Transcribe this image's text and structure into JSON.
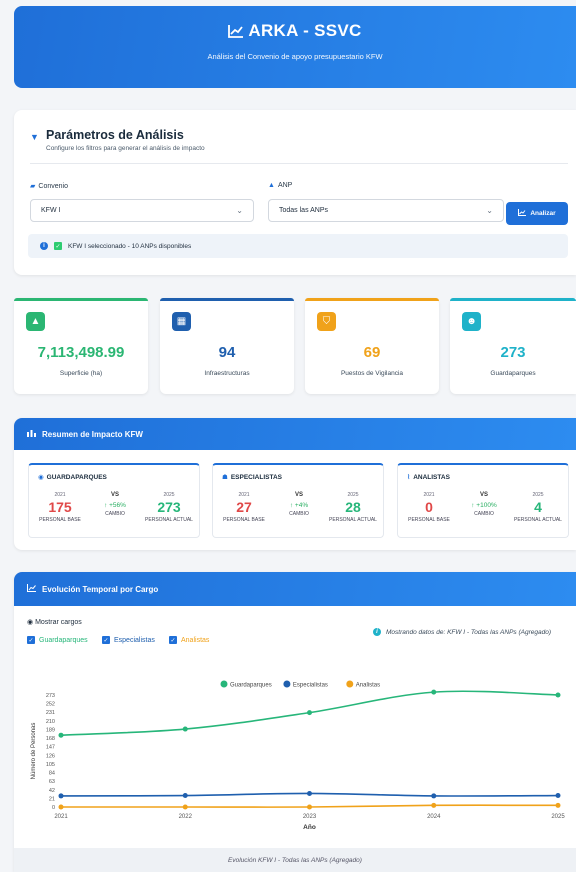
{
  "header": {
    "title": "ARKA - SSVC",
    "subtitle": "Análisis del Convenio de apoyo presupuestario KFW"
  },
  "params": {
    "title": "Parámetros de Análisis",
    "subtitle": "Configure los filtros para generar el análisis de impacto",
    "convenio_label": "Convenio",
    "convenio_value": "KFW I",
    "anp_label": "ANP",
    "anp_value": "Todas las ANPs",
    "analyze_button": "Analizar",
    "info_text": "KFW I seleccionado - 10 ANPs disponibles"
  },
  "stats": [
    {
      "value": "7,113,498.99",
      "label": "Superficie (ha)",
      "color": "#2bb673",
      "icon": "mountain-icon"
    },
    {
      "value": "94",
      "label": "Infraestructuras",
      "color": "#1f5fae",
      "icon": "building-icon"
    },
    {
      "value": "69",
      "label": "Puestos de Vigilancia",
      "color": "#f0a21a",
      "icon": "shield-icon"
    },
    {
      "value": "273",
      "label": "Guardaparques",
      "color": "#1fb2c9",
      "icon": "user-group-icon"
    }
  ],
  "impact": {
    "title": "Resumen de Impacto KFW",
    "vs_label": "VS",
    "cambio_label": "CAMBIO",
    "base_label": "PERSONAL BASE",
    "actual_label": "PERSONAL ACTUAL",
    "year_base": "2021",
    "year_actual": "2025",
    "cards": [
      {
        "name": "GUARDAPARQUES",
        "base": "175",
        "change": "↑ +56%",
        "actual": "273"
      },
      {
        "name": "ESPECIALISTAS",
        "base": "27",
        "change": "↑ +4%",
        "actual": "28"
      },
      {
        "name": "ANALISTAS",
        "base": "0",
        "change": "↑ +100%",
        "actual": "4"
      }
    ]
  },
  "evolution": {
    "title": "Evolución Temporal por Cargo",
    "show_label": "Mostrar cargos",
    "toggles": [
      "Guardaparques",
      "Especialistas",
      "Analistas"
    ],
    "showing_text": "Mostrando datos de: KFW I - Todas las ANPs (Agregado)",
    "footer": "Evolución KFW I - Todas las ANPs (Agregado)"
  },
  "colors": {
    "guardaparques": "#27b67a",
    "especialistas": "#1f5fae",
    "analistas": "#f0a21a",
    "accent": "#1f6fd8"
  },
  "chart_data": {
    "type": "line",
    "x": [
      "2021",
      "2022",
      "2023",
      "2024",
      "2025"
    ],
    "series": [
      {
        "name": "Guardaparques",
        "values": [
          175,
          190,
          230,
          280,
          273
        ]
      },
      {
        "name": "Especialistas",
        "values": [
          27,
          28,
          33,
          27,
          28
        ]
      },
      {
        "name": "Analistas",
        "values": [
          0,
          0,
          0,
          4,
          4
        ]
      }
    ],
    "xlabel": "Año",
    "ylabel": "Número de Personas",
    "yticks": [
      0,
      21,
      42,
      63,
      84,
      105,
      126,
      147,
      168,
      189,
      210,
      231,
      252,
      273
    ],
    "ylim": [
      0,
      273
    ],
    "legend": "top-center",
    "grid": false
  }
}
